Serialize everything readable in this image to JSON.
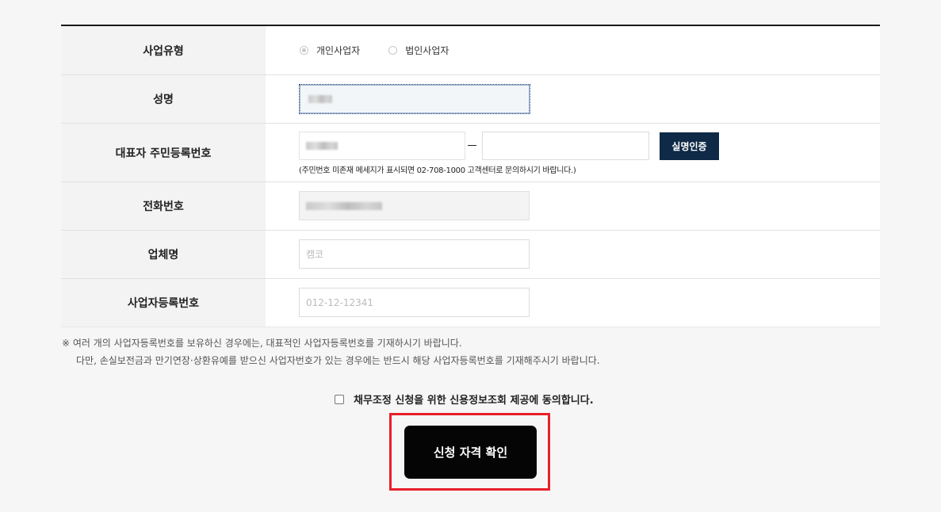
{
  "form": {
    "business_type": {
      "label": "사업유형",
      "options": [
        {
          "label": "개인사업자",
          "selected": true
        },
        {
          "label": "법인사업자",
          "selected": false
        }
      ]
    },
    "name": {
      "label": "성명",
      "value_redacted": true
    },
    "rrn": {
      "label": "대표자 주민등록번호",
      "verify_button": "실명인증",
      "note": "(주민번호 미존재 메세지가 표시되면 02-708-1000 고객센터로 문의하시기 바랍니다.)"
    },
    "phone": {
      "label": "전화번호",
      "value_redacted": true
    },
    "company": {
      "label": "업체명",
      "placeholder": "캠코"
    },
    "bizno": {
      "label": "사업자등록번호",
      "placeholder": "012-12-12341"
    }
  },
  "notice": {
    "line1": "※ 여러 개의 사업자등록번호를 보유하신 경우에는, 대표적인 사업자등록번호를 기재하시기 바랍니다.",
    "line2": "다만, 손실보전금과 만기연장·상환유예를 받으신 사업자번호가 있는 경우에는 반드시 해당 사업자등록번호를 기재해주시기 바랍니다."
  },
  "consent": {
    "label": "채무조정 신청을 위한 신용정보조회 제공에 동의합니다.",
    "checked": false
  },
  "submit": {
    "label": "신청 자격 확인"
  },
  "colors": {
    "verify_button_bg": "#0f2a47",
    "submit_button_bg": "#050505",
    "highlight_border": "#e8202a",
    "header_cell_bg": "#f3f3f3"
  }
}
